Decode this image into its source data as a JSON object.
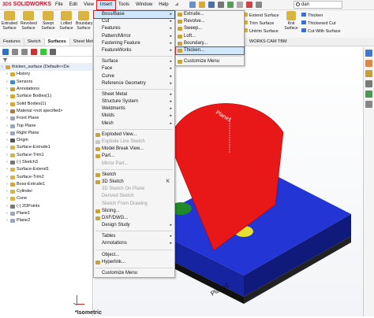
{
  "app": {
    "logo_text": "SOLIDWORKS",
    "logo_ds": "3DS"
  },
  "menubar": [
    "File",
    "Edit",
    "View",
    "Insert",
    "Tools",
    "Window",
    "Help",
    "⊿"
  ],
  "ribbon_left": [
    {
      "label": "Extruded Surface",
      "color": "#c9a227"
    },
    {
      "label": "Revolved Surface",
      "color": "#c9a227"
    },
    {
      "label": "Swept Surface",
      "color": "#c9a227"
    },
    {
      "label": "Lofted Surface",
      "color": "#c9a227"
    },
    {
      "label": "Boundary Surface",
      "color": "#c9a227"
    }
  ],
  "ribbon_right": [
    {
      "label": "Extend Surface"
    },
    {
      "label": "Trim Surface"
    },
    {
      "label": "Untrim Surface"
    },
    {
      "label": "Knit Surface"
    },
    {
      "label": "Thicken"
    },
    {
      "label": "Thickened Cut"
    },
    {
      "label": "Cut With Surface"
    }
  ],
  "search_value": "dan",
  "tabs": [
    "Features",
    "Sketch",
    "Surfaces",
    "Sheet Metal"
  ],
  "tab_right": "WORKS CAM TBM",
  "tree": {
    "root": "thicken_surface (Default<<De",
    "items": [
      {
        "label": "History",
        "icon": "folder"
      },
      {
        "label": "Sensors",
        "icon": "sensor"
      },
      {
        "label": "Annotations",
        "icon": "annot"
      },
      {
        "label": "Surface Bodies(1)",
        "icon": "folder"
      },
      {
        "label": "Solid Bodies(1)",
        "icon": "folder"
      },
      {
        "label": "Material <not specified>",
        "icon": "material"
      },
      {
        "label": "Front Plane",
        "icon": "plane"
      },
      {
        "label": "Top Plane",
        "icon": "plane"
      },
      {
        "label": "Right Plane",
        "icon": "plane"
      },
      {
        "label": "Origin",
        "icon": "origin"
      },
      {
        "label": "Surface-Extrude1",
        "icon": "surface"
      },
      {
        "label": "Surface-Trim1",
        "icon": "surface"
      },
      {
        "label": "(-) Sketch3",
        "icon": "sketch"
      },
      {
        "label": "Surface-Extend1",
        "icon": "surface"
      },
      {
        "label": "Surface-Trim2",
        "icon": "surface"
      },
      {
        "label": "Boss-Extrude1",
        "icon": "boss"
      },
      {
        "label": "Cylinder",
        "icon": "surface"
      },
      {
        "label": "Cone",
        "icon": "surface"
      },
      {
        "label": "(-) 2DPoints",
        "icon": "sketch"
      },
      {
        "label": "Plane1",
        "icon": "plane"
      },
      {
        "label": "Plane2",
        "icon": "plane"
      }
    ]
  },
  "insert_menu": [
    {
      "label": "Boss/Base",
      "arrow": true,
      "hl": true
    },
    {
      "label": "Cut",
      "arrow": true
    },
    {
      "label": "Features",
      "arrow": true
    },
    {
      "label": "Pattern/Mirror",
      "arrow": true
    },
    {
      "label": "Fastening Feature",
      "arrow": true
    },
    {
      "label": "FeatureWorks",
      "arrow": true
    },
    {
      "sep": true
    },
    {
      "label": "Surface",
      "arrow": true
    },
    {
      "label": "Face",
      "arrow": true
    },
    {
      "label": "Curve",
      "arrow": true
    },
    {
      "label": "Reference Geometry",
      "arrow": true
    },
    {
      "sep": true
    },
    {
      "label": "Sheet Metal",
      "arrow": true
    },
    {
      "label": "Structure System",
      "arrow": true
    },
    {
      "label": "Weldments",
      "arrow": true
    },
    {
      "label": "Molds",
      "arrow": true
    },
    {
      "label": "Mesh",
      "arrow": true
    },
    {
      "sep": true
    },
    {
      "label": "Exploded View...",
      "icon": true
    },
    {
      "label": "Explode Line Sketch",
      "dis": true,
      "icon": true
    },
    {
      "label": "Model Break View...",
      "icon": true
    },
    {
      "label": "Part...",
      "icon": true
    },
    {
      "label": "Mirror Part...",
      "dis": true
    },
    {
      "sep": true
    },
    {
      "label": "Sketch",
      "icon": true
    },
    {
      "label": "3D Sketch",
      "key": "K",
      "icon": true
    },
    {
      "label": "3D Sketch On Plane",
      "dis": true
    },
    {
      "label": "Derived Sketch",
      "dis": true
    },
    {
      "label": "Sketch From Drawing",
      "dis": true
    },
    {
      "label": "Slicing...",
      "icon": true
    },
    {
      "label": "DXF/DWG...",
      "icon": true
    },
    {
      "label": "Design Study",
      "arrow": true
    },
    {
      "sep": true
    },
    {
      "label": "Tables",
      "arrow": true
    },
    {
      "label": "Annotations",
      "arrow": true
    },
    {
      "sep": true
    },
    {
      "label": "Object..."
    },
    {
      "label": "Hyperlink...",
      "icon": true
    },
    {
      "sep": true
    },
    {
      "label": "Customize Menu"
    }
  ],
  "boss_submenu": [
    {
      "label": "Extrude..."
    },
    {
      "label": "Revolve..."
    },
    {
      "label": "Sweep..."
    },
    {
      "label": "Loft..."
    },
    {
      "label": "Boundary..."
    },
    {
      "label": "Thicken...",
      "hl": true
    },
    {
      "sep": true
    },
    {
      "label": "Customize Menu"
    }
  ],
  "viewport": {
    "plane_label_1": "Plane1",
    "plane_label_2": "Plane2",
    "view_label": "*Isometric"
  },
  "colors": {
    "accent": "#e02020",
    "block": "#1f2fc4",
    "red_surface": "#e81818",
    "green": "#1e8a2a",
    "yellow": "#e8e030"
  }
}
